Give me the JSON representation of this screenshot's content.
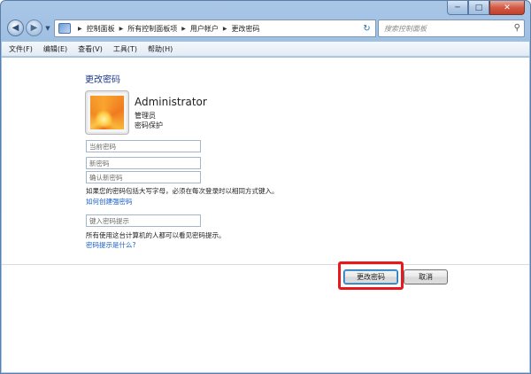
{
  "window": {
    "minimize_glyph": "─",
    "maximize_glyph": "□",
    "close_glyph": "✕"
  },
  "nav": {
    "back_glyph": "◀",
    "forward_glyph": "▶",
    "breadcrumbs": [
      "控制面板",
      "所有控制面板项",
      "用户帐户",
      "更改密码"
    ],
    "breadcrumb_separator": "▶",
    "refresh_glyph": "↻",
    "search_placeholder": "搜索控制面板",
    "search_glyph": "⚲"
  },
  "menu": [
    "文件(F)",
    "编辑(E)",
    "查看(V)",
    "工具(T)",
    "帮助(H)"
  ],
  "page": {
    "title": "更改密码",
    "user": {
      "name": "Administrator",
      "role": "管理员",
      "protection": "密码保护"
    },
    "fields": {
      "current_password_placeholder": "当前密码",
      "new_password_placeholder": "新密码",
      "confirm_password_placeholder": "确认新密码",
      "hint_placeholder": "键入密码提示"
    },
    "caps_note": "如果您的密码包括大写字母，必须在每次登录时以相同方式键入。",
    "strong_password_link": "如何创建强密码",
    "hint_note": "所有使用这台计算机的人都可以看见密码提示。",
    "hint_link": "密码提示是什么?",
    "buttons": {
      "change": "更改密码",
      "cancel": "取消"
    }
  },
  "colors": {
    "highlight": "#e8191c",
    "link": "#1a5fc8",
    "title": "#1e3a8a"
  }
}
